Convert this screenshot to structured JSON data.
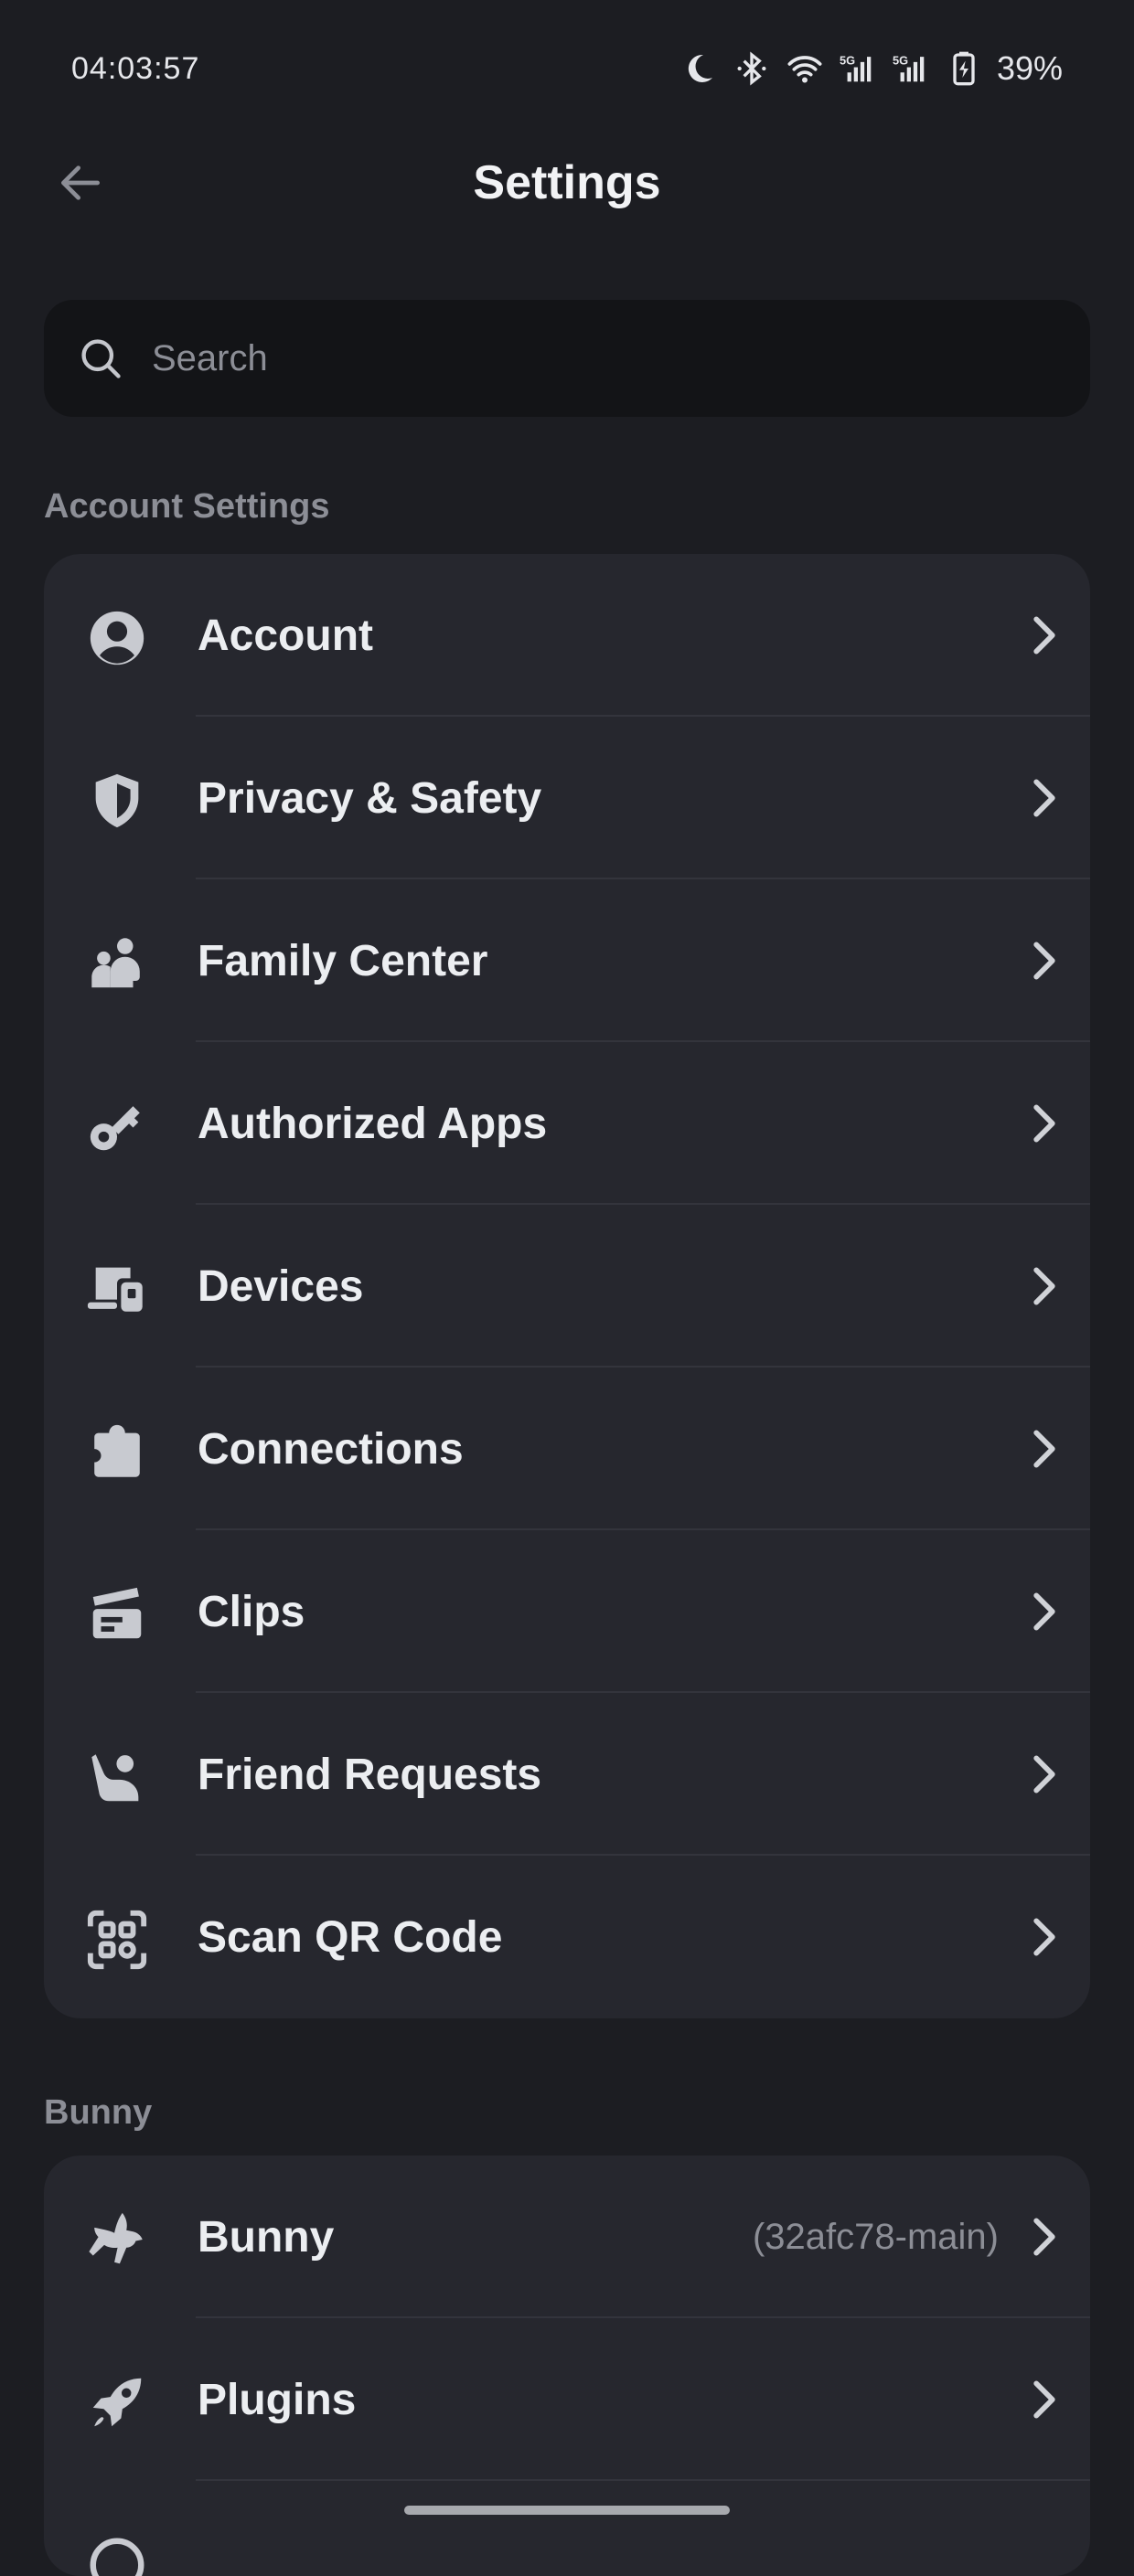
{
  "status_bar": {
    "time": "04:03:57",
    "battery": "39%",
    "network_1": "5G",
    "network_2": "5G"
  },
  "header": {
    "title": "Settings"
  },
  "search": {
    "placeholder": "Search"
  },
  "sections": {
    "account": {
      "heading": "Account Settings",
      "items": [
        {
          "label": "Account",
          "icon": "account-circle-icon"
        },
        {
          "label": "Privacy & Safety",
          "icon": "shield-icon"
        },
        {
          "label": "Family Center",
          "icon": "family-icon"
        },
        {
          "label": "Authorized Apps",
          "icon": "key-icon"
        },
        {
          "label": "Devices",
          "icon": "devices-icon"
        },
        {
          "label": "Connections",
          "icon": "puzzle-icon"
        },
        {
          "label": "Clips",
          "icon": "clapperboard-icon"
        },
        {
          "label": "Friend Requests",
          "icon": "waving-person-icon"
        },
        {
          "label": "Scan QR Code",
          "icon": "qr-code-icon"
        }
      ]
    },
    "bunny": {
      "heading": "Bunny",
      "items": [
        {
          "label": "Bunny",
          "value": "(32afc78-main)",
          "icon": "bunny-icon"
        },
        {
          "label": "Plugins",
          "icon": "rocket-icon"
        }
      ]
    }
  },
  "colors": {
    "background": "#1c1d22",
    "card": "#26272e",
    "search_bg": "#131417",
    "text_primary": "#eceef1",
    "text_muted": "#8c8e96"
  }
}
